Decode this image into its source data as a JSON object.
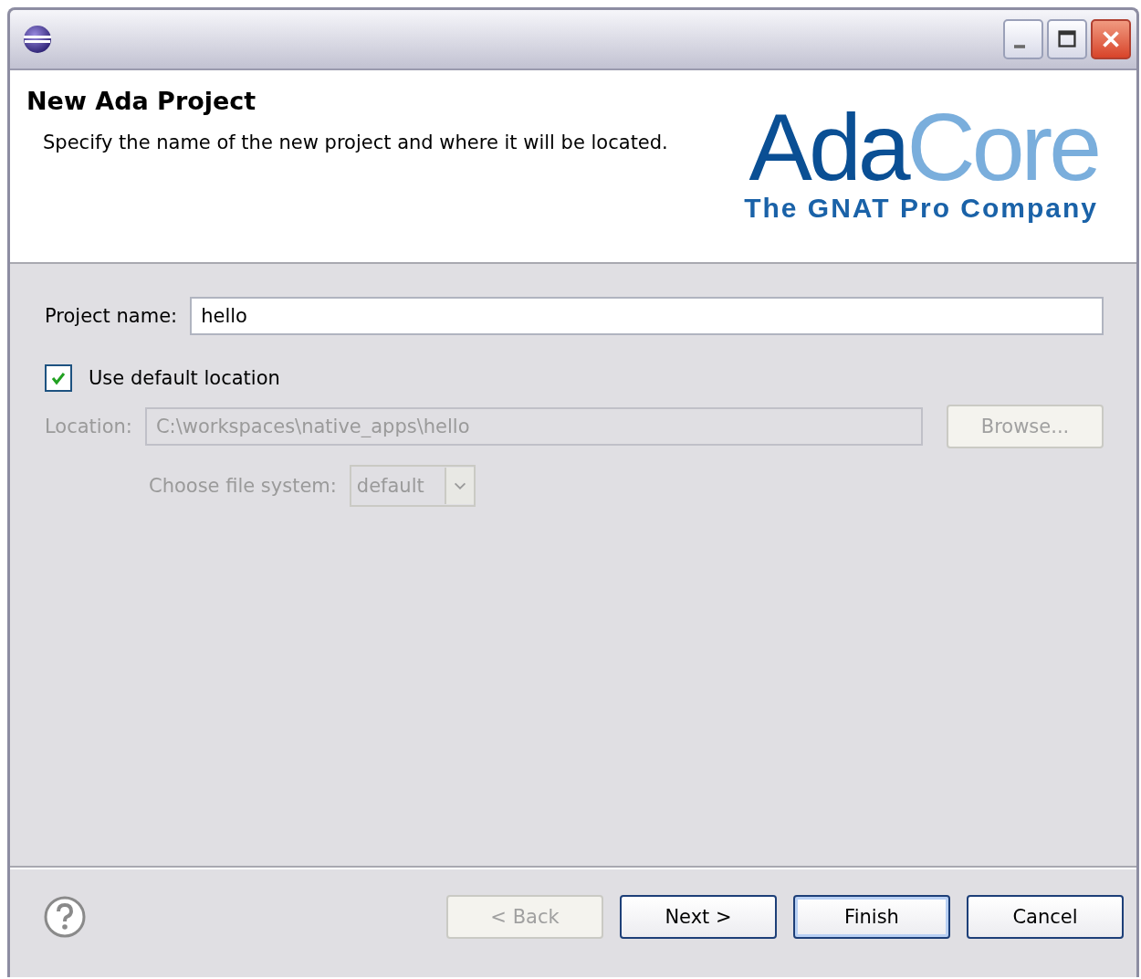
{
  "window": {
    "controls": [
      {
        "kind": "minimize"
      },
      {
        "kind": "maximize"
      },
      {
        "kind": "close"
      }
    ]
  },
  "header": {
    "title": "New Ada Project",
    "description": "Specify the name of the new project and where it will be located.",
    "logo": {
      "name_parts": [
        "Ada",
        "Core"
      ],
      "tagline": "The GNAT Pro Company"
    }
  },
  "form": {
    "project_name": {
      "label": "Project name:",
      "value": "hello"
    },
    "use_default_location": {
      "label": "Use default location",
      "checked": true
    },
    "location": {
      "label": "Location:",
      "value": "C:\\workspaces\\native_apps\\hello",
      "disabled": true,
      "button": "Browse..."
    },
    "file_system": {
      "label": "Choose file system:",
      "value": "default",
      "disabled": true
    }
  },
  "buttons": [
    {
      "label": "< Back",
      "disabled": true,
      "default": false
    },
    {
      "label": "Next >",
      "disabled": false,
      "default": false
    },
    {
      "label": "Finish",
      "disabled": false,
      "default": true
    },
    {
      "label": "Cancel",
      "disabled": false,
      "default": false
    }
  ]
}
